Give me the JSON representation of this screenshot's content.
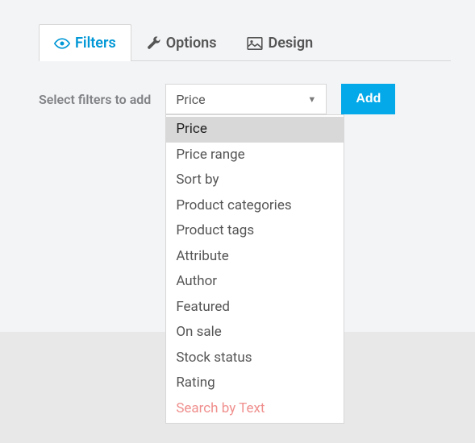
{
  "tabs": {
    "filters": "Filters",
    "options": "Options",
    "design": "Design"
  },
  "panel": {
    "label": "Select filters to add",
    "selected": "Price",
    "add_label": "Add",
    "options": [
      "Price",
      "Price range",
      "Sort by",
      "Product categories",
      "Product tags",
      "Attribute",
      "Author",
      "Featured",
      "On sale",
      "Stock status",
      "Rating",
      "Search by Text"
    ]
  }
}
